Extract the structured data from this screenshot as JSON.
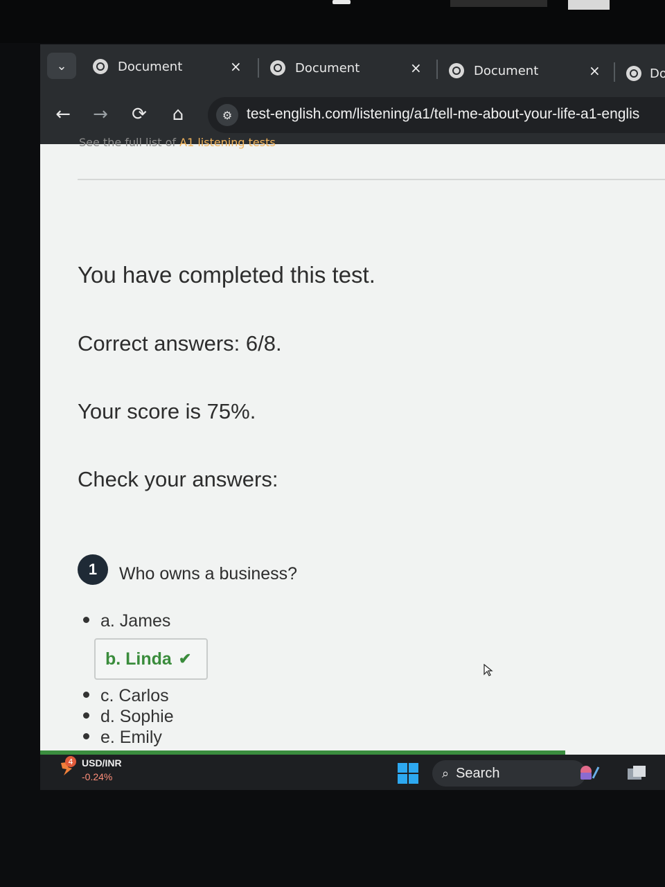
{
  "browser": {
    "tabs": [
      {
        "title": "Document"
      },
      {
        "title": "Document"
      },
      {
        "title": "Document"
      },
      {
        "title": "Do"
      }
    ],
    "tab_close_glyph": "×",
    "url": "test-english.com/listening/a1/tell-me-about-your-life-a1-englis"
  },
  "page": {
    "faded_text": "See the full list of ",
    "faded_link": "A1 listening tests",
    "completed": "You have completed this test.",
    "correct_answers": "Correct answers: 6/8.",
    "score": "Your score is 75%.",
    "check_answers": "Check your answers:",
    "question": {
      "number": "1",
      "text": "Who owns a business?",
      "options": [
        {
          "label": "a. James",
          "correct": false
        },
        {
          "label": "b. Linda",
          "correct": true
        },
        {
          "label": "c. Carlos",
          "correct": false
        },
        {
          "label": "d. Sophie",
          "correct": false
        },
        {
          "label": "e. Emily",
          "correct": false
        }
      ]
    }
  },
  "taskbar": {
    "badge_count": "4",
    "ticker_name": "USD/INR",
    "ticker_change": "-0.24%",
    "search_label": "Search"
  },
  "colors": {
    "correct_green": "#3a8c3c",
    "accent_link": "#f0b25a",
    "browser_dark": "#2a2d30"
  }
}
